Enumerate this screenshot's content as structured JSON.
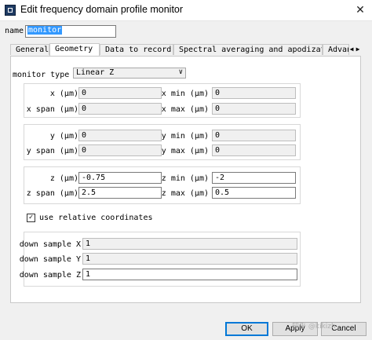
{
  "window": {
    "title": "Edit frequency domain profile monitor",
    "close_glyph": "✕"
  },
  "name": {
    "label": "name",
    "value": "monitor"
  },
  "tabs": [
    {
      "label": "General"
    },
    {
      "label": "Geometry"
    },
    {
      "label": "Data to record"
    },
    {
      "label": "Spectral averaging and apodization"
    },
    {
      "label": "Advanced"
    }
  ],
  "tab_scroll": {
    "left": "◀",
    "right": "▶"
  },
  "geometry": {
    "monitor_type": {
      "label": "monitor type",
      "value": "Linear Z"
    },
    "x": {
      "label": "x (μm)",
      "value": "0",
      "span_label": "x span (μm)",
      "span": "0",
      "min_label": "x min (μm)",
      "min": "0",
      "max_label": "x max (μm)",
      "max": "0"
    },
    "y": {
      "label": "y (μm)",
      "value": "0",
      "span_label": "y span (μm)",
      "span": "0",
      "min_label": "y min (μm)",
      "min": "0",
      "max_label": "y max (μm)",
      "max": "0"
    },
    "z": {
      "label": "z (μm)",
      "value": "-0.75",
      "span_label": "z span (μm)",
      "span": "2.5",
      "min_label": "z min (μm)",
      "min": "-2",
      "max_label": "z max (μm)",
      "max": "0.5"
    },
    "relative": {
      "label": "use relative coordinates",
      "checked": true
    },
    "downsample": [
      {
        "label": "down sample X",
        "value": "1"
      },
      {
        "label": "down sample Y",
        "value": "1"
      },
      {
        "label": "down sample Z",
        "value": "1"
      }
    ]
  },
  "buttons": {
    "ok": "OK",
    "apply": "Apply",
    "cancel": "Cancel"
  },
  "watermark": "知乎 @kikizh"
}
